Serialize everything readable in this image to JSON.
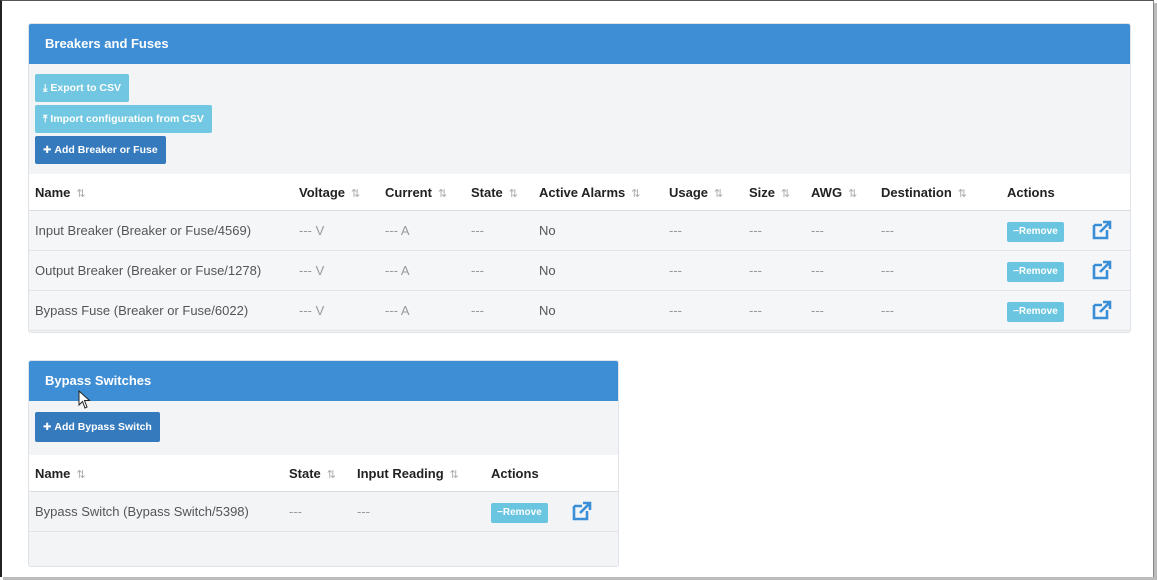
{
  "breakers_panel": {
    "title": "Breakers and Fuses",
    "export_label": "Export to CSV",
    "import_label": "Import configuration from CSV",
    "add_label": "Add Breaker or Fuse",
    "columns": [
      "Name",
      "Voltage",
      "Current",
      "State",
      "Active Alarms",
      "Usage",
      "Size",
      "AWG",
      "Destination",
      "Actions"
    ],
    "rows": [
      {
        "name": "Input Breaker (Breaker or Fuse/4569)",
        "voltage": "--- V",
        "current": "--- A",
        "state": "---",
        "alarms": "No",
        "usage": "---",
        "size": "---",
        "awg": "---",
        "destination": "---",
        "remove": "Remove"
      },
      {
        "name": "Output Breaker (Breaker or Fuse/1278)",
        "voltage": "--- V",
        "current": "--- A",
        "state": "---",
        "alarms": "No",
        "usage": "---",
        "size": "---",
        "awg": "---",
        "destination": "---",
        "remove": "Remove"
      },
      {
        "name": "Bypass Fuse (Breaker or Fuse/6022)",
        "voltage": "--- V",
        "current": "--- A",
        "state": "---",
        "alarms": "No",
        "usage": "---",
        "size": "---",
        "awg": "---",
        "destination": "---",
        "remove": "Remove"
      }
    ]
  },
  "bypass_panel": {
    "title": "Bypass Switches",
    "add_label": "Add Bypass Switch",
    "columns": [
      "Name",
      "State",
      "Input Reading",
      "Actions"
    ],
    "rows": [
      {
        "name": "Bypass Switch (Bypass Switch/5398)",
        "state": "---",
        "input_reading": "---",
        "remove": "Remove"
      }
    ]
  },
  "colors": {
    "header_blue": "#3e8ed6",
    "info_button": "#5bc0de",
    "primary_button": "#357abd"
  },
  "icons": {
    "download": "download-icon",
    "upload": "upload-icon",
    "plus": "plus-icon",
    "minus": "minus-icon",
    "external_link": "external-link-icon",
    "sort": "sort-icon"
  }
}
